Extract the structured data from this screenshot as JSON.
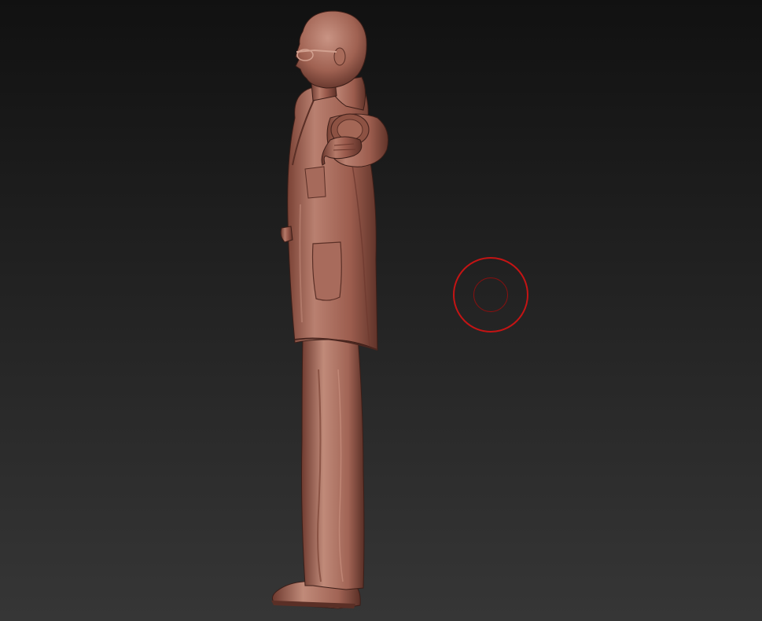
{
  "viewport": {
    "background_top": "#111111",
    "background_bottom": "#363636"
  },
  "model": {
    "material_color": "#9a5a4c",
    "highlight_color": "#c28876",
    "shadow_color": "#5e3128"
  },
  "brush_cursor": {
    "icon": "brush-circle-icon",
    "color": "#c41414"
  }
}
